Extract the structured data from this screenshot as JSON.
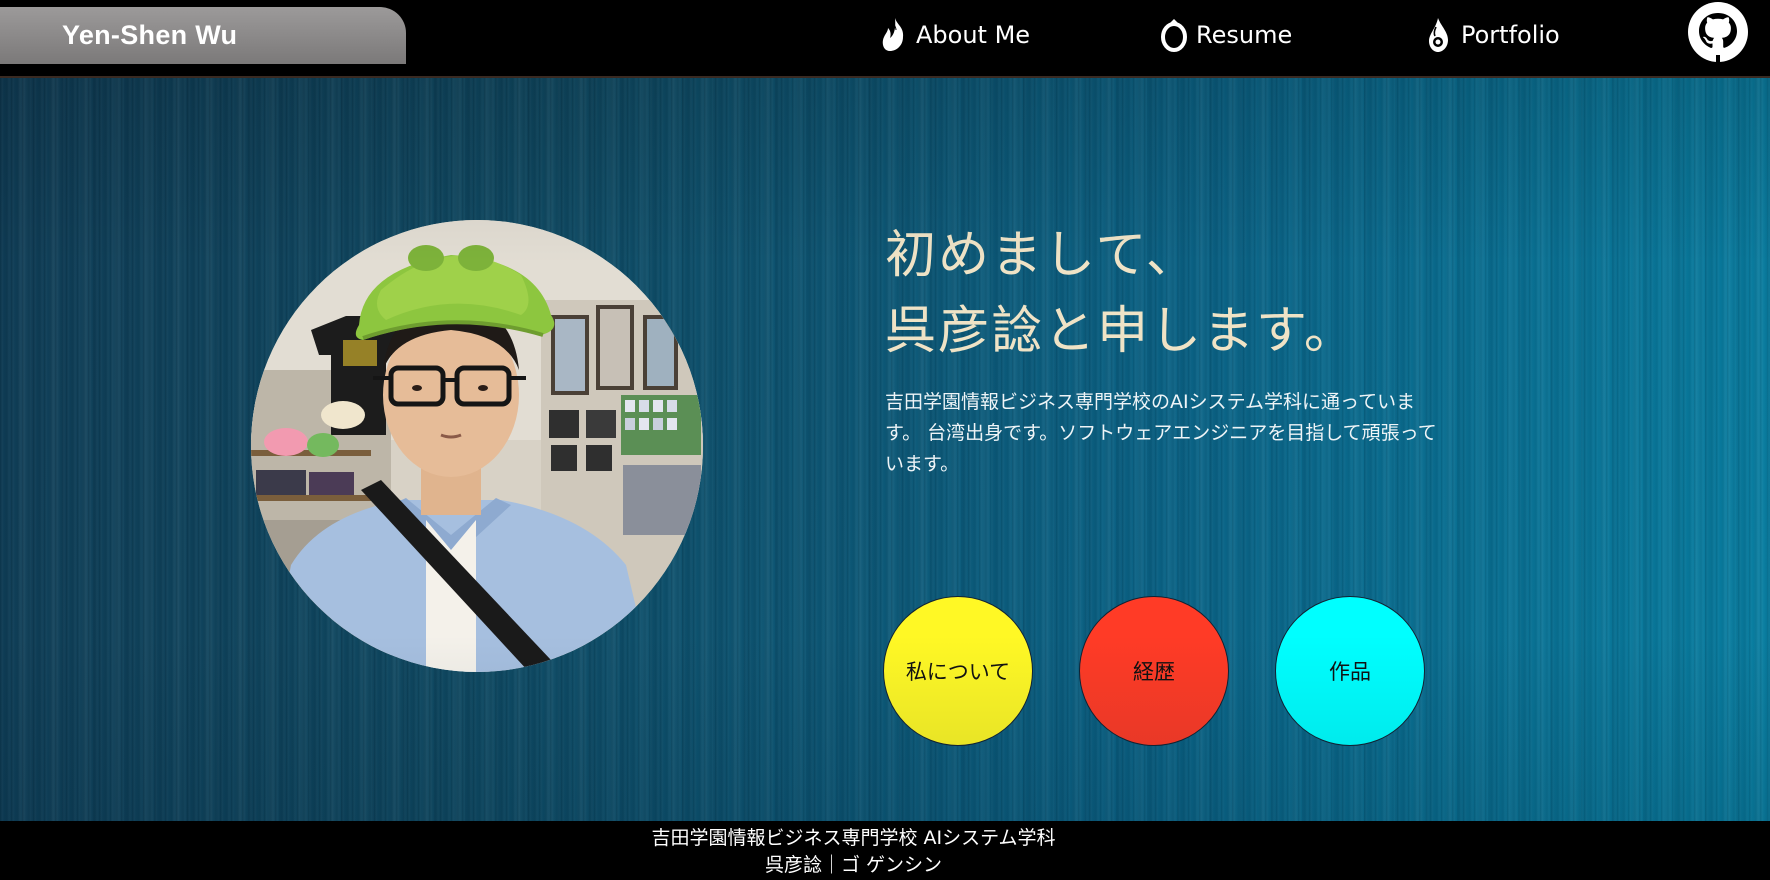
{
  "header": {
    "brand": "Yen-Shen Wu",
    "nav": [
      {
        "label": "About Me",
        "icon": "flame-icon"
      },
      {
        "label": "Resume",
        "icon": "ring-icon"
      },
      {
        "label": "Portfolio",
        "icon": "droplet-icon"
      }
    ],
    "github_icon": "github-icon"
  },
  "hero": {
    "headline_line1": "初めまして、",
    "headline_line2": "呉彦諗と申します。",
    "bio": "吉田学園情報ビジネス専門学校のAIシステム学科に通っています。 台湾出身です。ソフトウェアエンジニアを目指して頑張っています。",
    "buttons": [
      {
        "label": "私について",
        "color": "#fff825"
      },
      {
        "label": "経歴",
        "color": "#ff3b26"
      },
      {
        "label": "作品",
        "color": "#00ffff"
      }
    ]
  },
  "footer": {
    "school": "吉田学園情報ビジネス専門学校 AIシステム学科",
    "name": "呉彦諗｜ゴ ゲンシン"
  },
  "colors": {
    "headline": "#efe3c6",
    "hero_bg_left": "#0f3c55",
    "hero_bg_right": "#087fa2"
  }
}
